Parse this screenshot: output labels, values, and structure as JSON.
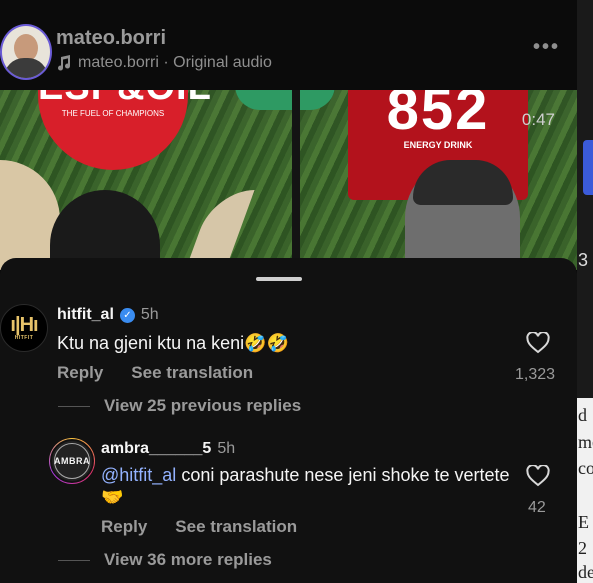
{
  "video": {
    "timecode": "0:47",
    "banner_left_big": "ESP&OIL",
    "banner_left_small": "THE FUEL OF CHAMPIONS",
    "banner_right_big": "852",
    "banner_right_small": "ENERGY DRINK"
  },
  "header": {
    "username": "mateo.borri",
    "audio_label": "mateo.borri · Original audio",
    "more_label": "•••"
  },
  "right_strip": {
    "text_1": "d",
    "text_2": "me",
    "text_3": "co",
    "text_4": "E",
    "text_5": "2",
    "text_6": "de",
    "edge_char": "3"
  },
  "comment": {
    "avatar_letters": "H",
    "avatar_text": "HITFIT",
    "username": "hitfit_al",
    "time": "5h",
    "text": "Ktu na gjeni ktu na keni🤣🤣",
    "reply_label": "Reply",
    "translate_label": "See translation",
    "likes": "1,323",
    "view_previous_label": "View 25 previous replies"
  },
  "reply": {
    "avatar_text": "AMBRA",
    "username": "ambra______5",
    "time": "5h",
    "mention": "@hitfit_al",
    "text": " coni parashute nese jeni shoke te vertete 🤝",
    "reply_label": "Reply",
    "translate_label": "See translation",
    "likes": "42"
  },
  "footer": {
    "view_more_label": "View 36 more replies"
  },
  "colors": {
    "sheet_bg": "#111111",
    "mention": "#93b2ff",
    "verified": "#3a8cf0"
  }
}
